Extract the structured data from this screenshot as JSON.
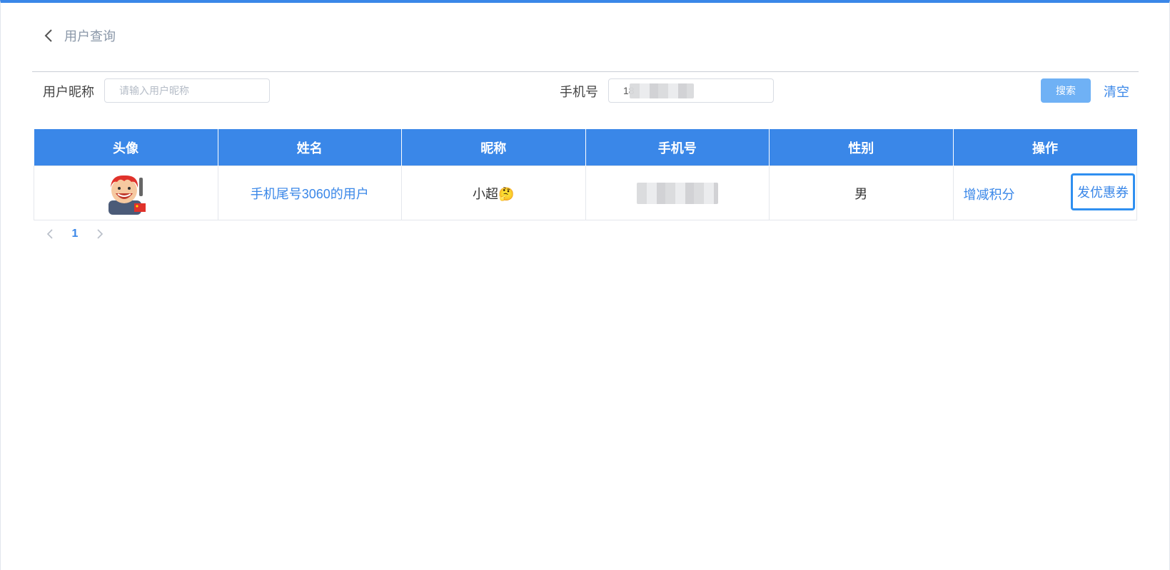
{
  "colors": {
    "accent": "#3a87e8",
    "search_button_bg": "#6fb1f5"
  },
  "header": {
    "back_icon": "chevron-left-icon",
    "title": "用户查询"
  },
  "filters": {
    "nickname_label": "用户昵称",
    "nickname_placeholder": "请输入用户昵称",
    "nickname_value": "",
    "phone_label": "手机号",
    "phone_value": "18",
    "search_label": "搜索",
    "clear_label": "清空"
  },
  "table": {
    "columns": [
      "头像",
      "姓名",
      "昵称",
      "手机号",
      "性别",
      "操作"
    ],
    "rows": [
      {
        "avatar_icon": "cartoon-avatar",
        "name": "手机尾号3060的用户",
        "nickname": "小超🤔",
        "phone": "",
        "gender": "男",
        "action_points": "增减积分",
        "action_coupon": "发优惠券"
      }
    ]
  },
  "pagination": {
    "prev_icon": "chevron-left-icon",
    "current_page": "1",
    "next_icon": "chevron-right-icon"
  }
}
